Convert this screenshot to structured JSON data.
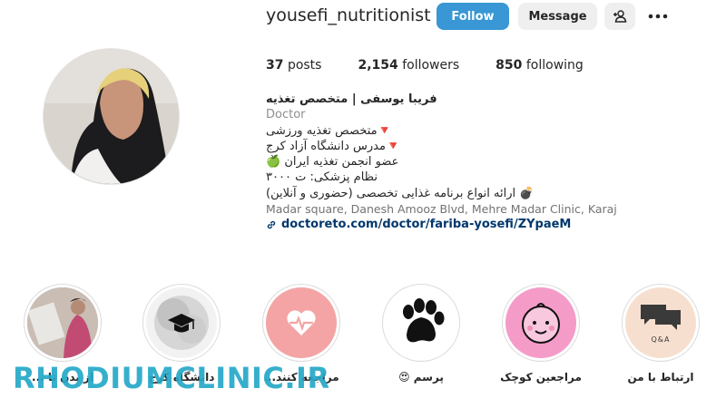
{
  "profile": {
    "username": "yousefi_nutritionist",
    "follow_label": "Follow",
    "message_label": "Message"
  },
  "stats": {
    "posts_count": "37",
    "posts_label": "posts",
    "followers_count": "2,154",
    "followers_label": "followers",
    "following_count": "850",
    "following_label": "following"
  },
  "bio": {
    "name": "فریبا یوسفی | متخصص تغذیه",
    "category": "Doctor",
    "lines": [
      "🔻متخصص تغذیه ورزشی",
      "🔻مدرس دانشگاه آزاد کرج",
      "عضو انجمن تغذیه ایران 🍏",
      "نظام پزشکی: ت ۳۰۰۰",
      "💣 ارائه انواع برنامه غذایی تخصصی (حضوری و آنلاین)"
    ],
    "address": "Madar square, Danesh Amooz Blvd, Mehre Madar Clinic, Karaj",
    "link": "doctoreto.com/doctor/fariba-yosefi/ZYpaeM"
  },
  "highlights": [
    {
      "label": "پرسم 😍",
      "icon": "paw-icon"
    },
    {
      "label": "مراجعین کوچک",
      "icon": "baby-face-icon"
    },
    {
      "label": "ارتباط با من",
      "icon": "chat-bubbles-icon",
      "badge": "Q&A"
    },
    {
      "label": "مراجعه کنند...",
      "icon": "heart-pulse-icon"
    },
    {
      "label": "دانشگاه کرج",
      "icon": "graduation-cap-icon"
    },
    {
      "label": "از بدن تا ...",
      "icon": "photo-icon"
    }
  ],
  "watermark": "RHODIUMCLINIC.IR",
  "colors": {
    "follow": "#3897d4",
    "link": "#00376b",
    "heart_bg": "#f4a4a4",
    "baby_bg": "#f49bc8",
    "chat_bg": "#f7dfcf",
    "watermark": "#25a9c8"
  }
}
